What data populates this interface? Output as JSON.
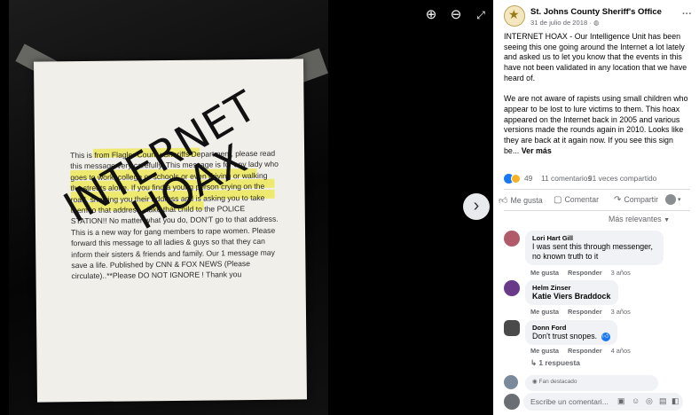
{
  "viewer": {
    "photo_text": "This is from Flagler County Sheriffs Department, please read this message very carefully. This message is for any lady who goes to work, college or schools or even driving or walking the streets alone. If you find a young person crying on the road, showing you their address and is asking you to take them to that address...take that child to the POLICE STATION!! No matter what you do, DON'T go to that address. This is a new way for gang members to rape women. Please forward this message to all ladies & guys so that they can inform their sisters & friends and family. Our 1 message may save a life. Published by CNN & FOX NEWS (Please circulate)..**Please DO NOT IGNORE ! Thank you",
    "stamp_line1": "INTERNET",
    "stamp_line2": "HOAX",
    "zoom_in_icon": "zoom-in-icon",
    "zoom_out_icon": "zoom-out-icon",
    "fullscreen_icon": "fullscreen-icon",
    "next_icon": "chevron-right-icon"
  },
  "post": {
    "page_name": "St. Johns County Sheriff's Office",
    "date": "31 de julio de 2018 · ",
    "paragraph1": "INTERNET HOAX - Our Intelligence Unit has been seeing this one going around the Internet a lot lately and asked us to let you know that the events in this have not been validated in any location that we have heard of.",
    "paragraph2": "We are not aware of rapists using small children who appear to be lost to lure victims to them. This hoax appeared on the Internet back in 2005 and various versions made the rounds again in 2010. Looks like they are back at it again now. If you see this sign be... ",
    "see_more": "Ver más",
    "reaction_count": "49",
    "comment_count": "11 comentarios",
    "share_count": "91 veces compartido"
  },
  "actions": {
    "like": "Me gusta",
    "comment": "Comentar",
    "share": "Compartir"
  },
  "sort_label": "Más relevantes",
  "comments": [
    {
      "name": "Lori Hart Gill",
      "text": "I was sent this through messenger, no known truth to it",
      "like": "Me gusta",
      "reply": "Responder",
      "time": "3 años"
    },
    {
      "name": "Helm Zinser",
      "text": "Katie Viers Braddock",
      "like": "Me gusta",
      "reply": "Responder",
      "time": "3 años"
    },
    {
      "name": "Donn Ford",
      "text": "Don't trust snopes.",
      "like": "Me gusta",
      "reply": "Responder",
      "time": "4 años",
      "replies": "1 respuesta"
    }
  ],
  "featured_label": "Fan destacado",
  "write_placeholder": "Escribe un comentari...",
  "colors": {
    "accent": "#1877f2",
    "panel_bg": "#ffffff",
    "viewer_bg": "#000000",
    "highlight": "#ece846"
  }
}
